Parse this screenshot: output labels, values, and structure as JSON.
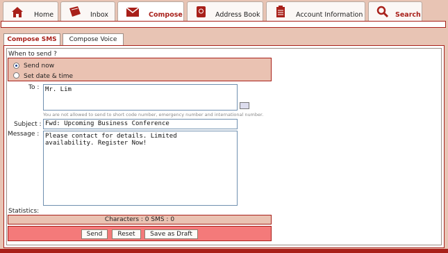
{
  "nav": {
    "tabs": [
      {
        "label": "Home",
        "icon": "home-icon"
      },
      {
        "label": "Inbox",
        "icon": "inbox-icon"
      },
      {
        "label": "Compose",
        "icon": "compose-icon"
      },
      {
        "label": "Address Book",
        "icon": "address-book-icon"
      },
      {
        "label": "Account Information",
        "icon": "account-info-icon"
      },
      {
        "label": "Search",
        "icon": "search-icon"
      }
    ],
    "active_tab": "Compose"
  },
  "compose_tabs": [
    {
      "label": "Compose SMS"
    },
    {
      "label": "Compose Voice"
    }
  ],
  "when": {
    "label": "When to send ?",
    "options": [
      "Send now",
      "Set date & time"
    ],
    "selected": "Send now"
  },
  "to": {
    "label": "To :",
    "value": "Mr. Lim",
    "note": "You are not allowed to send to short code number, emergency number and international number."
  },
  "subject": {
    "label": "Subject :",
    "value": "Fwd: Upcoming Business Conference"
  },
  "message": {
    "label": "Message :",
    "value": "Please contact for details. Limited\navailability. Register Now!"
  },
  "stats": {
    "label": "Statistics:",
    "text": "Characters : 0 SMS : 0"
  },
  "buttons": {
    "send": "Send",
    "reset": "Reset",
    "draft": "Save as Draft"
  },
  "colors": {
    "accent": "#a8201a",
    "page_bg": "#e8c4b4",
    "highlight_bg": "#eac2b2",
    "button_bar_bg": "#f47a7a"
  }
}
